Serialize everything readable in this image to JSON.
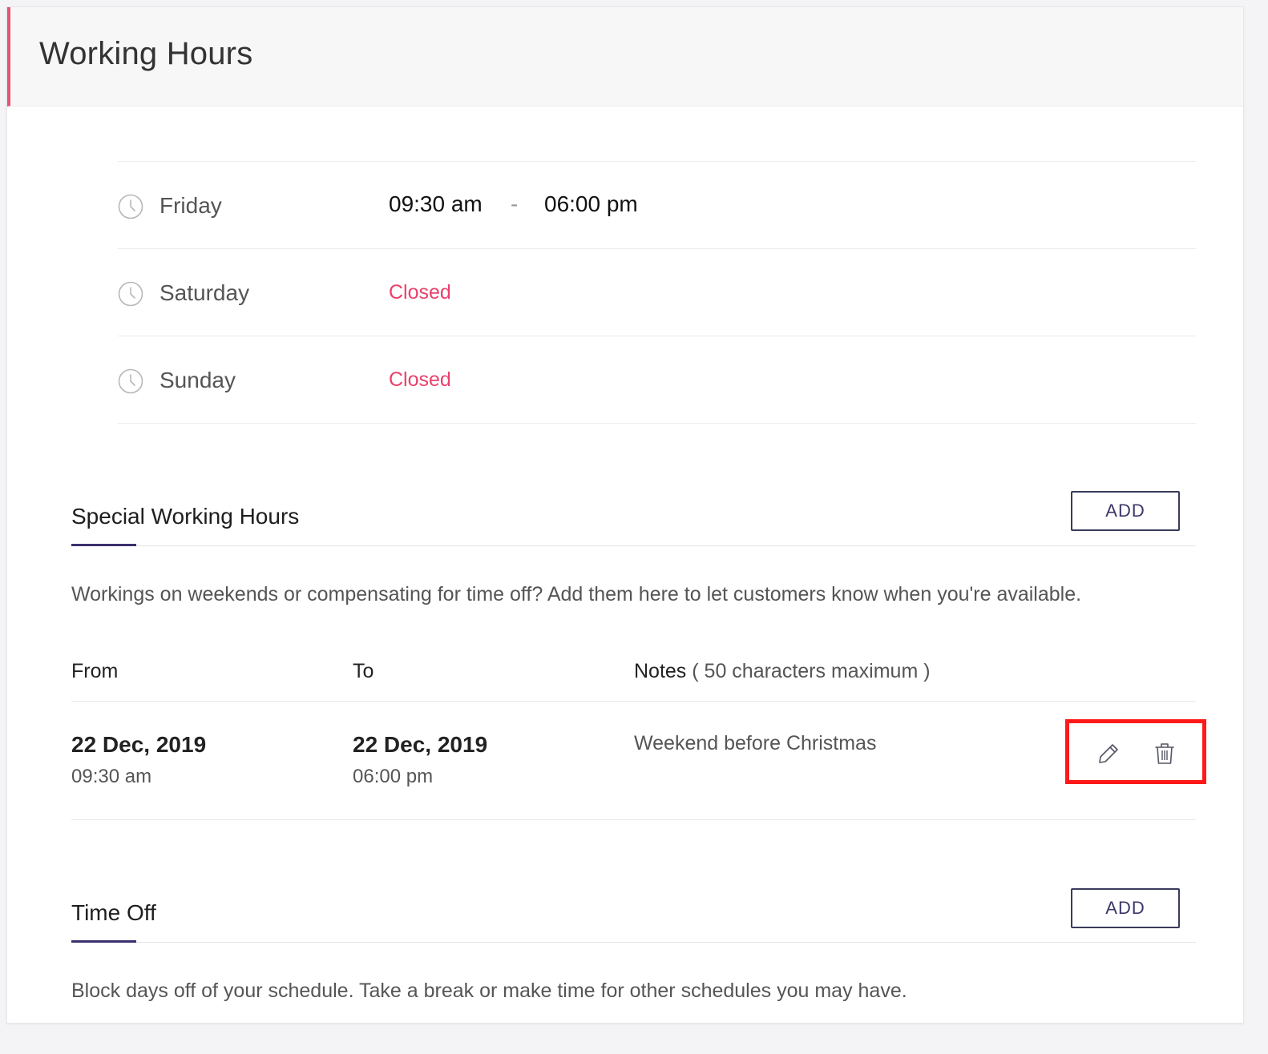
{
  "page": {
    "title": "Working Hours"
  },
  "days": [
    {
      "name": "Friday",
      "from": "09:30 am",
      "separator": "-",
      "to": "06:00 pm",
      "status": ""
    },
    {
      "name": "Saturday",
      "status": "Closed"
    },
    {
      "name": "Sunday",
      "status": "Closed"
    }
  ],
  "special_hours": {
    "title": "Special Working Hours",
    "add_label": "ADD",
    "description": "Workings on weekends or compensating for time off? Add them here to let customers know when you're available.",
    "columns": {
      "from": "From",
      "to": "To",
      "notes": "Notes",
      "notes_hint": "( 50 characters maximum )"
    },
    "rows": [
      {
        "from_date": "22 Dec, 2019",
        "from_time": "09:30 am",
        "to_date": "22 Dec, 2019",
        "to_time": "06:00 pm",
        "note": "Weekend before Christmas"
      }
    ]
  },
  "time_off": {
    "title": "Time Off",
    "add_label": "ADD",
    "description": "Block days off of your schedule. Take a break or make time for other schedules you may have."
  },
  "icons": {
    "clock": "clock-icon",
    "edit": "pencil-icon",
    "delete": "trash-icon"
  },
  "colors": {
    "accent": "#e8516f",
    "closed": "#e8416b",
    "section_accent": "#3c2f6e",
    "highlight": "#ff1a1a"
  }
}
